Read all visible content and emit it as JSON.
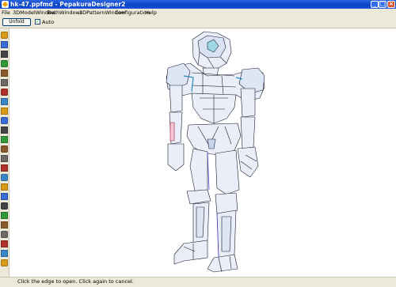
{
  "window": {
    "title": "hk-47.ppfmd - PepakuraDesigner2"
  },
  "menu": [
    "File",
    "3DModelWindow",
    "BothWindows",
    "2DPatternWindow",
    "Configuration",
    "Help"
  ],
  "toolbar": {
    "unfold_label": "Unfold",
    "auto_label": "Auto",
    "auto_checked": true
  },
  "sidebar": {
    "tools": [
      "open-icon",
      "save-icon",
      "pencil-icon",
      "eye-icon",
      "rotate-icon",
      "mirror-icon",
      "ruler-icon",
      "paint-icon",
      "fill-icon",
      "select-icon",
      "move-icon",
      "cut-icon",
      "join-icon",
      "flap-icon",
      "text-icon",
      "page-icon",
      "grid-icon",
      "layout-icon",
      "print-icon",
      "zoom-icon",
      "home-icon",
      "settings-icon",
      "copy-icon",
      "list-icon",
      "check-icon"
    ]
  },
  "status": {
    "text": "Click the edge to open. Click again to cancel."
  }
}
